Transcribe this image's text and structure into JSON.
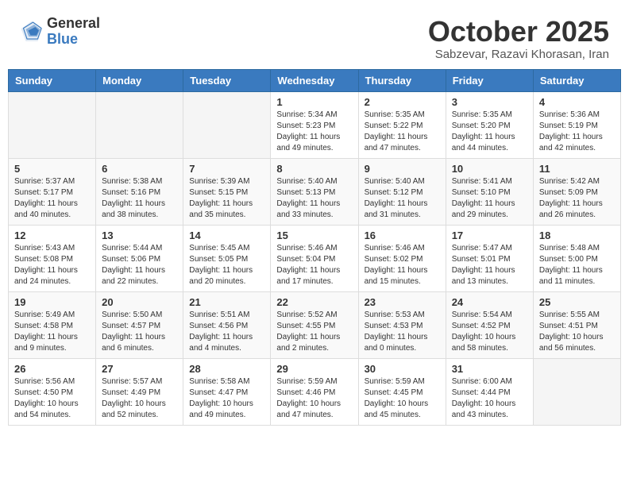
{
  "header": {
    "logo_general": "General",
    "logo_blue": "Blue",
    "month": "October 2025",
    "location": "Sabzevar, Razavi Khorasan, Iran"
  },
  "weekdays": [
    "Sunday",
    "Monday",
    "Tuesday",
    "Wednesday",
    "Thursday",
    "Friday",
    "Saturday"
  ],
  "weeks": [
    [
      {
        "day": "",
        "info": ""
      },
      {
        "day": "",
        "info": ""
      },
      {
        "day": "",
        "info": ""
      },
      {
        "day": "1",
        "info": "Sunrise: 5:34 AM\nSunset: 5:23 PM\nDaylight: 11 hours\nand 49 minutes."
      },
      {
        "day": "2",
        "info": "Sunrise: 5:35 AM\nSunset: 5:22 PM\nDaylight: 11 hours\nand 47 minutes."
      },
      {
        "day": "3",
        "info": "Sunrise: 5:35 AM\nSunset: 5:20 PM\nDaylight: 11 hours\nand 44 minutes."
      },
      {
        "day": "4",
        "info": "Sunrise: 5:36 AM\nSunset: 5:19 PM\nDaylight: 11 hours\nand 42 minutes."
      }
    ],
    [
      {
        "day": "5",
        "info": "Sunrise: 5:37 AM\nSunset: 5:17 PM\nDaylight: 11 hours\nand 40 minutes."
      },
      {
        "day": "6",
        "info": "Sunrise: 5:38 AM\nSunset: 5:16 PM\nDaylight: 11 hours\nand 38 minutes."
      },
      {
        "day": "7",
        "info": "Sunrise: 5:39 AM\nSunset: 5:15 PM\nDaylight: 11 hours\nand 35 minutes."
      },
      {
        "day": "8",
        "info": "Sunrise: 5:40 AM\nSunset: 5:13 PM\nDaylight: 11 hours\nand 33 minutes."
      },
      {
        "day": "9",
        "info": "Sunrise: 5:40 AM\nSunset: 5:12 PM\nDaylight: 11 hours\nand 31 minutes."
      },
      {
        "day": "10",
        "info": "Sunrise: 5:41 AM\nSunset: 5:10 PM\nDaylight: 11 hours\nand 29 minutes."
      },
      {
        "day": "11",
        "info": "Sunrise: 5:42 AM\nSunset: 5:09 PM\nDaylight: 11 hours\nand 26 minutes."
      }
    ],
    [
      {
        "day": "12",
        "info": "Sunrise: 5:43 AM\nSunset: 5:08 PM\nDaylight: 11 hours\nand 24 minutes."
      },
      {
        "day": "13",
        "info": "Sunrise: 5:44 AM\nSunset: 5:06 PM\nDaylight: 11 hours\nand 22 minutes."
      },
      {
        "day": "14",
        "info": "Sunrise: 5:45 AM\nSunset: 5:05 PM\nDaylight: 11 hours\nand 20 minutes."
      },
      {
        "day": "15",
        "info": "Sunrise: 5:46 AM\nSunset: 5:04 PM\nDaylight: 11 hours\nand 17 minutes."
      },
      {
        "day": "16",
        "info": "Sunrise: 5:46 AM\nSunset: 5:02 PM\nDaylight: 11 hours\nand 15 minutes."
      },
      {
        "day": "17",
        "info": "Sunrise: 5:47 AM\nSunset: 5:01 PM\nDaylight: 11 hours\nand 13 minutes."
      },
      {
        "day": "18",
        "info": "Sunrise: 5:48 AM\nSunset: 5:00 PM\nDaylight: 11 hours\nand 11 minutes."
      }
    ],
    [
      {
        "day": "19",
        "info": "Sunrise: 5:49 AM\nSunset: 4:58 PM\nDaylight: 11 hours\nand 9 minutes."
      },
      {
        "day": "20",
        "info": "Sunrise: 5:50 AM\nSunset: 4:57 PM\nDaylight: 11 hours\nand 6 minutes."
      },
      {
        "day": "21",
        "info": "Sunrise: 5:51 AM\nSunset: 4:56 PM\nDaylight: 11 hours\nand 4 minutes."
      },
      {
        "day": "22",
        "info": "Sunrise: 5:52 AM\nSunset: 4:55 PM\nDaylight: 11 hours\nand 2 minutes."
      },
      {
        "day": "23",
        "info": "Sunrise: 5:53 AM\nSunset: 4:53 PM\nDaylight: 11 hours\nand 0 minutes."
      },
      {
        "day": "24",
        "info": "Sunrise: 5:54 AM\nSunset: 4:52 PM\nDaylight: 10 hours\nand 58 minutes."
      },
      {
        "day": "25",
        "info": "Sunrise: 5:55 AM\nSunset: 4:51 PM\nDaylight: 10 hours\nand 56 minutes."
      }
    ],
    [
      {
        "day": "26",
        "info": "Sunrise: 5:56 AM\nSunset: 4:50 PM\nDaylight: 10 hours\nand 54 minutes."
      },
      {
        "day": "27",
        "info": "Sunrise: 5:57 AM\nSunset: 4:49 PM\nDaylight: 10 hours\nand 52 minutes."
      },
      {
        "day": "28",
        "info": "Sunrise: 5:58 AM\nSunset: 4:47 PM\nDaylight: 10 hours\nand 49 minutes."
      },
      {
        "day": "29",
        "info": "Sunrise: 5:59 AM\nSunset: 4:46 PM\nDaylight: 10 hours\nand 47 minutes."
      },
      {
        "day": "30",
        "info": "Sunrise: 5:59 AM\nSunset: 4:45 PM\nDaylight: 10 hours\nand 45 minutes."
      },
      {
        "day": "31",
        "info": "Sunrise: 6:00 AM\nSunset: 4:44 PM\nDaylight: 10 hours\nand 43 minutes."
      },
      {
        "day": "",
        "info": ""
      }
    ]
  ]
}
